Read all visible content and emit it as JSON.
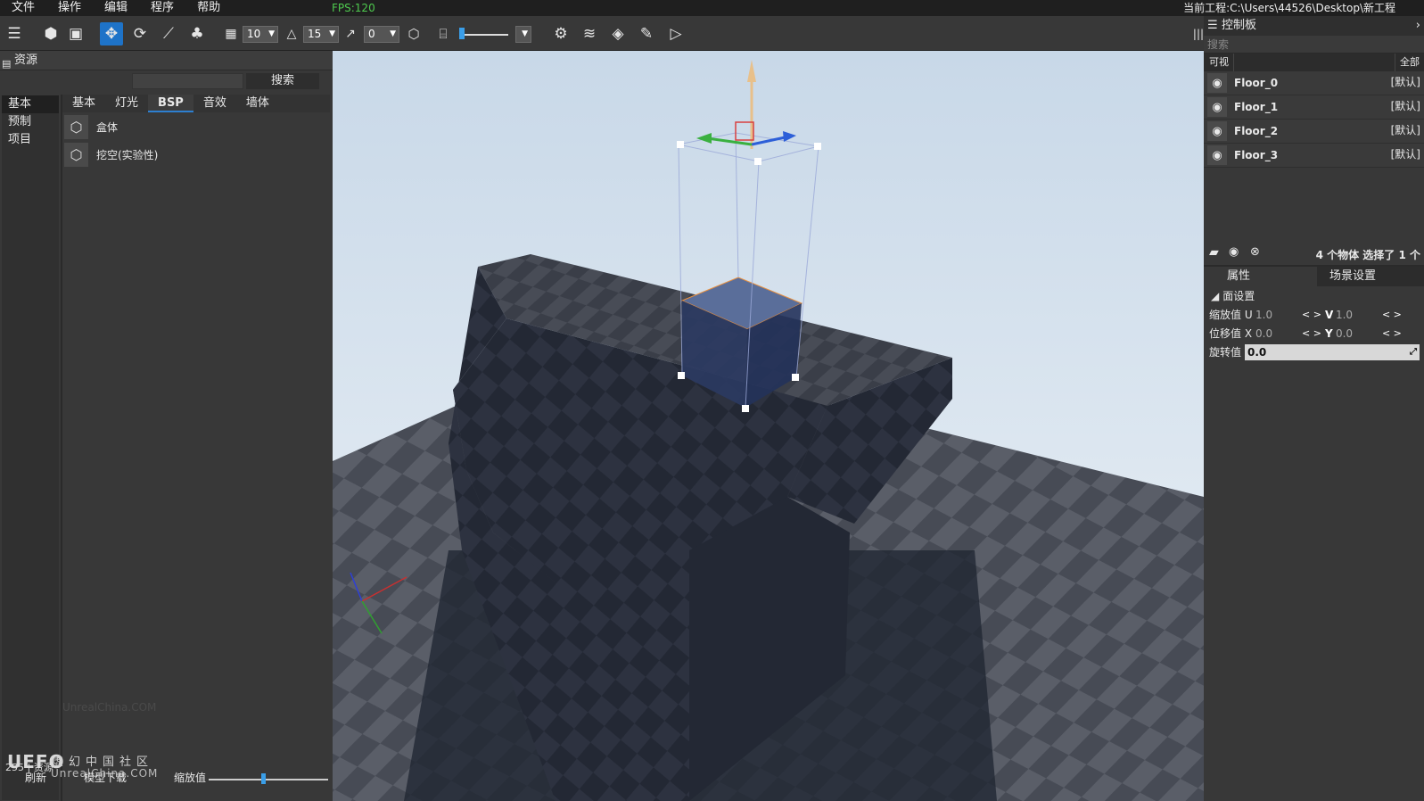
{
  "menu": {
    "items": [
      "文件",
      "操作",
      "编辑",
      "程序",
      "帮助"
    ],
    "fps": "FPS:120",
    "project": "当前工程:C:\\Users\\44526\\Desktop\\新工程"
  },
  "toolbar": {
    "grid_value": "10",
    "angle_value": "15",
    "scale_value": "0"
  },
  "assets": {
    "title": "资源",
    "search_button": "搜索",
    "nav": [
      "基本",
      "预制",
      "项目"
    ],
    "tabs": [
      "基本",
      "灯光",
      "BSP",
      "音效",
      "墙体"
    ],
    "items": [
      "盒体",
      "挖空(实验性)"
    ],
    "footer": {
      "counter": "255 | 资源",
      "refresh": "刷新",
      "download": "模型下载",
      "zoom_label": "缩放值"
    },
    "watermark_center": "UnrealChina.COM",
    "watermark_logo": "UEFO",
    "watermark_cn": "虚幻中国社区",
    "watermark_en": "UnrealChina.COM"
  },
  "panel": {
    "title": "控制板",
    "search_placeholder": "搜索",
    "col_visible": "可视",
    "col_all": "全部",
    "objects": [
      {
        "name": "Floor_0",
        "layer": "[默认]"
      },
      {
        "name": "Floor_1",
        "layer": "[默认]"
      },
      {
        "name": "Floor_2",
        "layer": "[默认]"
      },
      {
        "name": "Floor_3",
        "layer": "[默认]"
      }
    ],
    "status": "4 个物体  选择了 1 个"
  },
  "properties": {
    "tab_props": "属性",
    "tab_scene": "场景设置",
    "section": "面设置",
    "scale_label": "缩放值 U",
    "scale_u": "1.0",
    "v_label": "V",
    "scale_v": "1.0",
    "offset_label": "位移值 X",
    "offset_x": "0.0",
    "y_label": "Y",
    "offset_y": "0.0",
    "rotate_label": "旋转值",
    "rotate_value": "0.0"
  }
}
